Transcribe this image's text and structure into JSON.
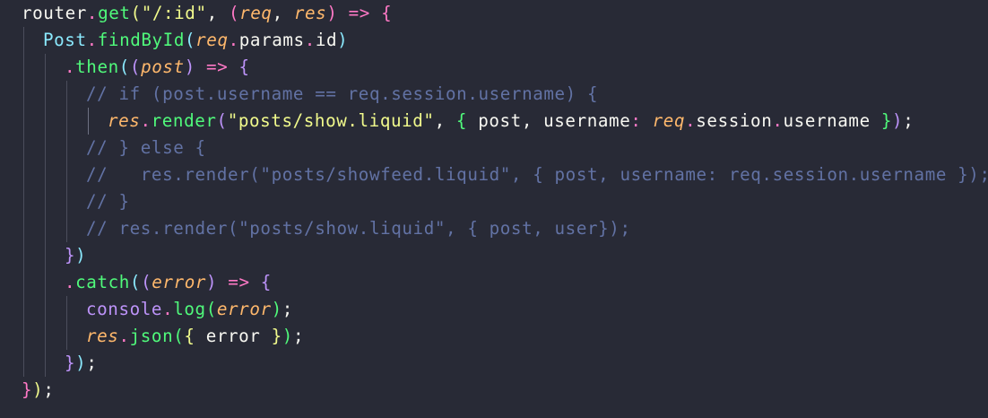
{
  "editor": {
    "language": "javascript",
    "theme": "dark",
    "colors": {
      "background": "#282a36",
      "function": "#50fa7b",
      "string": "#f1fa8c",
      "parameter": "#ffb86c",
      "keyword": "#ff79c6",
      "class": "#8be9fd",
      "object": "#bd93f9",
      "comment": "#6272a4",
      "plain": "#f8f8f2"
    },
    "lines": [
      {
        "indent": 0,
        "tokens": [
          {
            "t": "router",
            "c": "pl"
          },
          {
            "t": ".",
            "c": "kw"
          },
          {
            "t": "get",
            "c": "fn"
          },
          {
            "t": "(",
            "c": "b1"
          },
          {
            "t": "\"/:id\"",
            "c": "str"
          },
          {
            "t": ", ",
            "c": "pl"
          },
          {
            "t": "(",
            "c": "b2"
          },
          {
            "t": "req",
            "c": "par"
          },
          {
            "t": ", ",
            "c": "pl"
          },
          {
            "t": "res",
            "c": "par"
          },
          {
            "t": ")",
            "c": "b2"
          },
          {
            "t": " => ",
            "c": "kw"
          },
          {
            "t": "{",
            "c": "b2"
          }
        ]
      },
      {
        "indent": 1,
        "tokens": [
          {
            "t": "Post",
            "c": "cls"
          },
          {
            "t": ".",
            "c": "kw"
          },
          {
            "t": "findById",
            "c": "fn"
          },
          {
            "t": "(",
            "c": "b3"
          },
          {
            "t": "req",
            "c": "par"
          },
          {
            "t": ".",
            "c": "kw"
          },
          {
            "t": "params",
            "c": "pl"
          },
          {
            "t": ".",
            "c": "kw"
          },
          {
            "t": "id",
            "c": "pl"
          },
          {
            "t": ")",
            "c": "b3"
          }
        ]
      },
      {
        "indent": 2,
        "tokens": [
          {
            "t": ".",
            "c": "kw"
          },
          {
            "t": "then",
            "c": "fn"
          },
          {
            "t": "(",
            "c": "b3"
          },
          {
            "t": "(",
            "c": "b4"
          },
          {
            "t": "post",
            "c": "par"
          },
          {
            "t": ")",
            "c": "b4"
          },
          {
            "t": " => ",
            "c": "kw"
          },
          {
            "t": "{",
            "c": "b4"
          }
        ]
      },
      {
        "indent": 3,
        "tokens": [
          {
            "t": "// if (post.username == req.session.username) {",
            "c": "cm"
          }
        ]
      },
      {
        "indent": 4,
        "tokens": [
          {
            "t": "res",
            "c": "par"
          },
          {
            "t": ".",
            "c": "kw"
          },
          {
            "t": "render",
            "c": "fn"
          },
          {
            "t": "(",
            "c": "b4"
          },
          {
            "t": "\"posts/show.liquid\"",
            "c": "str"
          },
          {
            "t": ", ",
            "c": "pl"
          },
          {
            "t": "{",
            "c": "b5"
          },
          {
            "t": " post, username",
            "c": "pl"
          },
          {
            "t": ": ",
            "c": "kw"
          },
          {
            "t": "req",
            "c": "par"
          },
          {
            "t": ".",
            "c": "kw"
          },
          {
            "t": "session",
            "c": "pl"
          },
          {
            "t": ".",
            "c": "kw"
          },
          {
            "t": "username ",
            "c": "pl"
          },
          {
            "t": "}",
            "c": "b5"
          },
          {
            "t": ")",
            "c": "b4"
          },
          {
            "t": ";",
            "c": "pl"
          }
        ]
      },
      {
        "indent": 3,
        "tokens": [
          {
            "t": "// } else {",
            "c": "cm"
          }
        ]
      },
      {
        "indent": 3,
        "tokens": [
          {
            "t": "//   res.render(\"posts/showfeed.liquid\", { post, username: req.session.username });",
            "c": "cm"
          }
        ]
      },
      {
        "indent": 3,
        "tokens": [
          {
            "t": "// }",
            "c": "cm"
          }
        ]
      },
      {
        "indent": 3,
        "tokens": [
          {
            "t": "// res.render(\"posts/show.liquid\", { post, user});",
            "c": "cm"
          }
        ]
      },
      {
        "indent": 2,
        "tokens": [
          {
            "t": "}",
            "c": "b4"
          },
          {
            "t": ")",
            "c": "b3"
          }
        ]
      },
      {
        "indent": 2,
        "tokens": [
          {
            "t": ".",
            "c": "kw"
          },
          {
            "t": "catch",
            "c": "fn"
          },
          {
            "t": "(",
            "c": "b3"
          },
          {
            "t": "(",
            "c": "b4"
          },
          {
            "t": "error",
            "c": "par"
          },
          {
            "t": ")",
            "c": "b4"
          },
          {
            "t": " => ",
            "c": "kw"
          },
          {
            "t": "{",
            "c": "b4"
          }
        ]
      },
      {
        "indent": 3,
        "tokens": [
          {
            "t": "console",
            "c": "obj"
          },
          {
            "t": ".",
            "c": "kw"
          },
          {
            "t": "log",
            "c": "fn"
          },
          {
            "t": "(",
            "c": "b5"
          },
          {
            "t": "error",
            "c": "par"
          },
          {
            "t": ")",
            "c": "b5"
          },
          {
            "t": ";",
            "c": "pl"
          }
        ]
      },
      {
        "indent": 3,
        "tokens": [
          {
            "t": "res",
            "c": "par"
          },
          {
            "t": ".",
            "c": "kw"
          },
          {
            "t": "json",
            "c": "fn"
          },
          {
            "t": "(",
            "c": "b5"
          },
          {
            "t": "{",
            "c": "b1"
          },
          {
            "t": " error ",
            "c": "pl"
          },
          {
            "t": "}",
            "c": "b1"
          },
          {
            "t": ")",
            "c": "b5"
          },
          {
            "t": ";",
            "c": "pl"
          }
        ]
      },
      {
        "indent": 2,
        "tokens": [
          {
            "t": "}",
            "c": "b4"
          },
          {
            "t": ")",
            "c": "b3"
          },
          {
            "t": ";",
            "c": "pl"
          }
        ]
      },
      {
        "indent": 0,
        "tokens": [
          {
            "t": "}",
            "c": "b2"
          },
          {
            "t": ")",
            "c": "b1"
          },
          {
            "t": ";",
            "c": "pl"
          }
        ]
      }
    ]
  }
}
